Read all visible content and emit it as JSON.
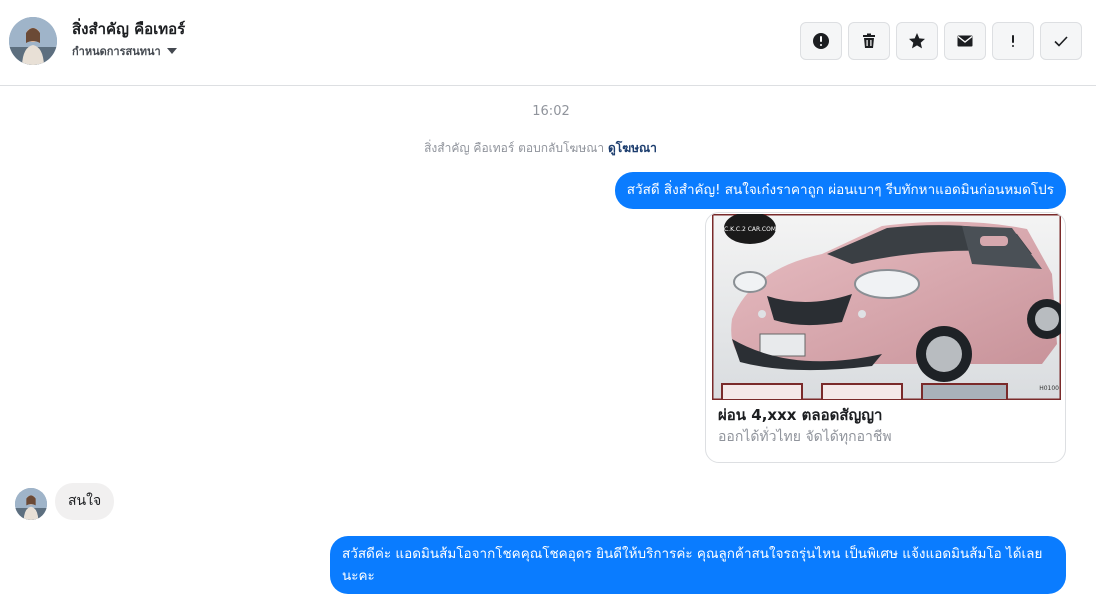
{
  "header": {
    "contact_name": "สิ่งสำคัญ คือเทอร์",
    "assign_label": "กำหนดการสนทนา",
    "toolbar": [
      {
        "name": "alert-icon",
        "label": "Mark as spam"
      },
      {
        "name": "trash-icon",
        "label": "Delete"
      },
      {
        "name": "star-icon",
        "label": "Star"
      },
      {
        "name": "mail-icon",
        "label": "Mark as unread"
      },
      {
        "name": "exclamation-icon",
        "label": "Follow up"
      },
      {
        "name": "check-icon",
        "label": "Mark as done"
      }
    ]
  },
  "conversation": {
    "timestamp": "16:02",
    "reply_notice": "สิ่งสำคัญ คือเทอร์ ตอบกลับโฆษณา",
    "reply_link": "ดูโฆษณา",
    "messages": [
      {
        "from": "page",
        "text": "สวัสดี สิ่งสำคัญ! สนใจเก๋งราคาถูก ผ่อนเบาๆ รีบทักหาแอดมินก่อนหมดโปร"
      },
      {
        "from": "user",
        "text": "สนใจ"
      },
      {
        "from": "page",
        "text": "สวัสดีค่ะ แอดมินส้มโอจากโชคคุณโชคอุดร ยินดีให้บริการค่ะ  คุณลูกค้าสนใจรถรุ่นไหน เป็นพิเศษ แจ้งแอดมินส้มโอ ได้เลยนะคะ"
      }
    ],
    "ad_card": {
      "title": "ผ่อน 4,xxx ตลอดสัญญา",
      "subtitle": "ออกได้ทั่วไทย จัดได้ทุกอาชีพ",
      "watermark": "C.K.C.2 CAR.COM",
      "tag": "H0100"
    }
  },
  "colors": {
    "accent": "#0a7cff",
    "bubble_in": "#f1f0f0",
    "border": "#dddfe2"
  }
}
